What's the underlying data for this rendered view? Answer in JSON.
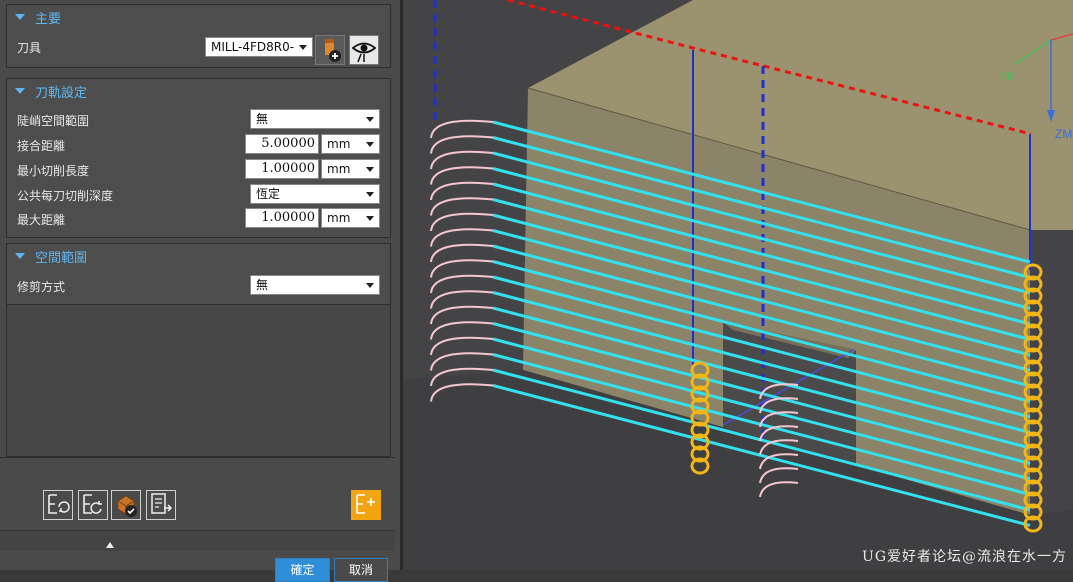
{
  "sections": {
    "main": {
      "title": "主要",
      "tool_label": "刀具",
      "tool_value": "MILL-4FD8R0-"
    },
    "toolpath": {
      "title": "刀軌設定",
      "rows": [
        {
          "label": "陡峭空間範圍",
          "value": "無"
        },
        {
          "label": "接合距離",
          "value": "5.00000",
          "unit": "mm"
        },
        {
          "label": "最小切削長度",
          "value": "1.00000",
          "unit": "mm"
        },
        {
          "label": "公共每刀切削深度",
          "value": "恆定"
        },
        {
          "label": "最大距離",
          "value": "1.00000",
          "unit": "mm"
        }
      ]
    },
    "space": {
      "title": "空間範圍",
      "trim_label": "修剪方式",
      "trim_value": "無"
    }
  },
  "buttons": {
    "ok": "確定",
    "cancel": "取消"
  },
  "axes": {
    "ym": "YM",
    "zm": "ZM"
  },
  "watermark": "UG爱好者论坛@流浪在水一方",
  "colors": {
    "accent": "#5fb6f0",
    "toolpath": "#33e0ee",
    "helix": "#f2b616",
    "block": "#9b9270"
  }
}
